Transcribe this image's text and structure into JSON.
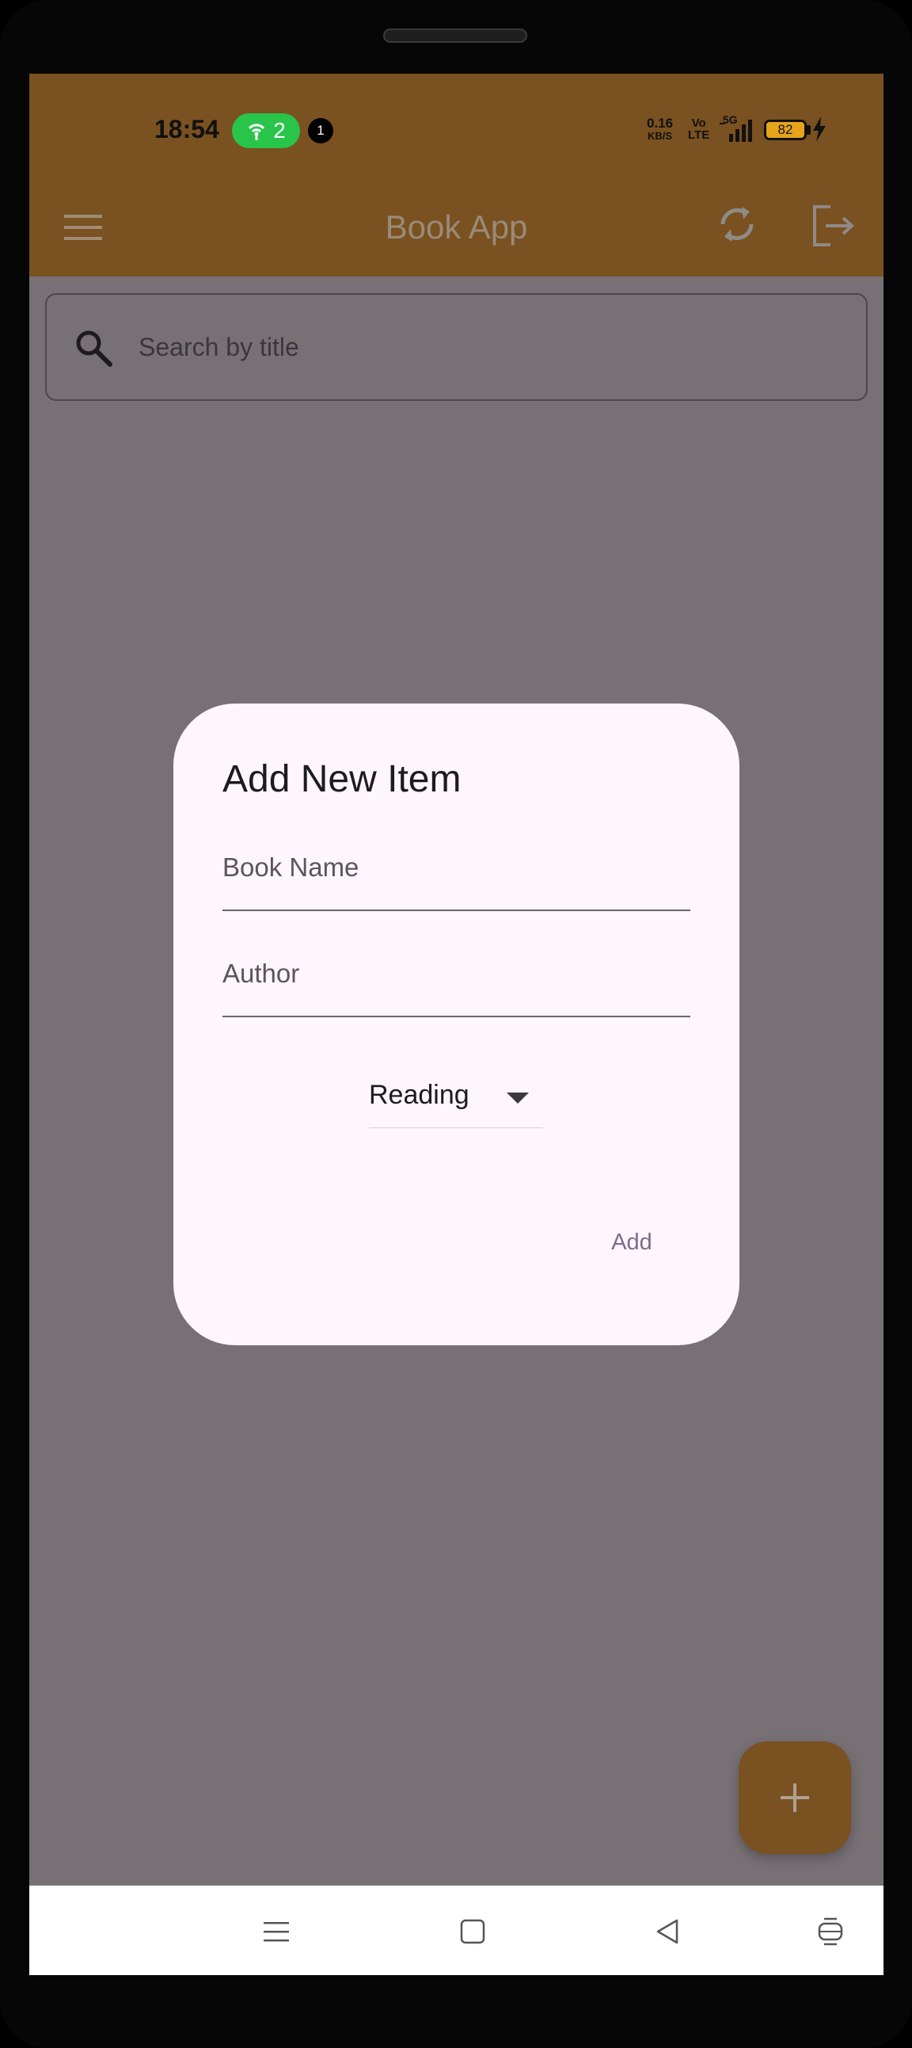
{
  "status_bar": {
    "time": "18:54",
    "hotspot_count": "2",
    "notification_count": "1",
    "net_speed_value": "0.16",
    "net_speed_unit": "KB/S",
    "volte_top": "Vo",
    "volte_bottom": "LTE",
    "network": "5G",
    "battery": "82"
  },
  "app_bar": {
    "title": "Book App",
    "icons": [
      "menu-icon",
      "sync-icon",
      "logout-icon"
    ]
  },
  "search": {
    "placeholder": "Search by title",
    "icon": "search-icon"
  },
  "dialog": {
    "title": "Add New Item",
    "book_name_placeholder": "Book Name",
    "author_placeholder": "Author",
    "status_selected": "Reading",
    "add_label": "Add"
  },
  "fab": {
    "icon": "plus-icon"
  },
  "nav_bar": {
    "items": [
      "menu-nav-icon",
      "home-nav-icon",
      "back-nav-icon",
      "switch-nav-icon"
    ]
  },
  "colors": {
    "app_bar": "#7a5120",
    "scrim_background": "#777176",
    "dialog_surface": "#fdf6fc",
    "add_button_text": "#7a6e8d",
    "hotspot_badge": "#29c44a",
    "battery": "#e5a41a"
  }
}
